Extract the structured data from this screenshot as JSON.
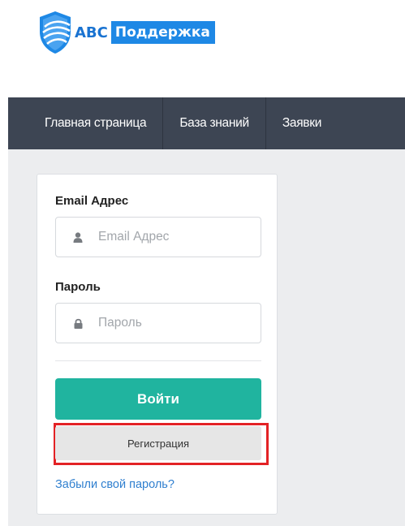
{
  "logo": {
    "abc": "ABC",
    "support": "Поддержка"
  },
  "nav": {
    "items": [
      {
        "label": "Главная страница"
      },
      {
        "label": "База знаний"
      },
      {
        "label": "Заявки"
      }
    ]
  },
  "login": {
    "email_label": "Email Адрес",
    "email_placeholder": "Email Адрес",
    "password_label": "Пароль",
    "password_placeholder": "Пароль",
    "login_button": "Войти",
    "register_button": "Регистрация",
    "forgot_link": "Забыли свой пароль?"
  },
  "colors": {
    "navbar": "#3d4553",
    "login_button": "#20b49f",
    "highlight": "#e32225",
    "link": "#2f7fcf",
    "brand": "#1e88e5"
  },
  "icons": {
    "logo": "shield-logo-icon",
    "email": "user-icon",
    "password": "lock-icon"
  }
}
